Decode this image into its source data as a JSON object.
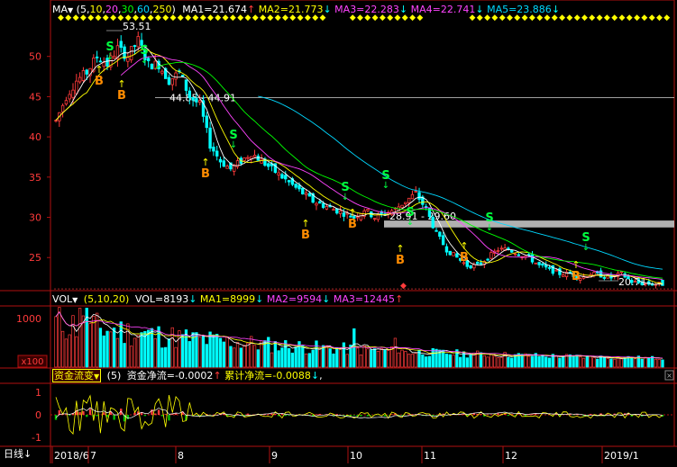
{
  "colors": {
    "bg": "#000000",
    "frame": "#b01010",
    "up": "#ff3b3b",
    "down": "#00ffff",
    "ma5": "#ffffff",
    "ma10": "#ffff00",
    "ma20": "#ff44ff",
    "ma30": "#00ff00",
    "ma60": "#00d8ff",
    "ma250": "#ffff00",
    "axis_text": "#ff3b3b",
    "grid": "#8b0000",
    "signal_b": "#ff8c00",
    "signal_s": "#00ff40",
    "ref": "#ffffff"
  },
  "main": {
    "indicator_label": "MA",
    "indicator_menu_icon": "triangle-down-icon",
    "params_open": "(",
    "params": [
      "5",
      "10",
      "20",
      "30",
      "60",
      "250"
    ],
    "params_close": ")",
    "ma1": "MA1=21.674",
    "ma2": "MA2=21.773",
    "ma3": "MA3=22.283",
    "ma4": "MA4=22.741",
    "ma5": "MA5=23.886",
    "y_ticks": [
      "50",
      "45",
      "40",
      "35",
      "30",
      "25"
    ],
    "annotations": {
      "high": "53.51",
      "low": "20.71",
      "band1": "44.85 - 44.91",
      "band2": "28.91 - 29.60"
    },
    "signal_buy": "B",
    "signal_sell": "S"
  },
  "volume": {
    "indicator_label": "VOL",
    "params": "(5,10,20)",
    "vol": "VOL=8193",
    "ma1": "MA1=8999",
    "ma2": "MA2=9594",
    "ma3": "MA3=12445",
    "y_tick": "1000",
    "unit": "x100"
  },
  "flow": {
    "indicator_label": "资金流变",
    "params": "(5)",
    "net": "资金净流=-0.0002",
    "cumulative": "累计净流=-0.0088",
    "trail": ",",
    "y_ticks": [
      "1",
      "0",
      "-1"
    ]
  },
  "bottom": {
    "period_label": "日线",
    "x_labels": [
      "2018/6",
      "7",
      "8",
      "9",
      "10",
      "11",
      "12",
      "2019/1"
    ]
  },
  "chart_data": [
    {
      "type": "candlestick",
      "title": "",
      "ylim": [
        21,
        55
      ],
      "y_ticks": [
        25,
        30,
        35,
        40,
        45,
        50
      ],
      "x_labels": [
        "2018/6",
        "7",
        "8",
        "9",
        "10",
        "11",
        "12",
        "2019/1"
      ],
      "close_path": [
        [
          0,
          42
        ],
        [
          3,
          45
        ],
        [
          6,
          47
        ],
        [
          9,
          48
        ],
        [
          12,
          50
        ],
        [
          15,
          49
        ],
        [
          18,
          51
        ],
        [
          21,
          50
        ],
        [
          24,
          52
        ],
        [
          27,
          49
        ],
        [
          30,
          49
        ],
        [
          33,
          47
        ],
        [
          36,
          48
        ],
        [
          39,
          45
        ],
        [
          42,
          44
        ],
        [
          45,
          39
        ],
        [
          48,
          37
        ],
        [
          51,
          36
        ],
        [
          54,
          37
        ],
        [
          57,
          38
        ],
        [
          60,
          37
        ],
        [
          63,
          36
        ],
        [
          66,
          35
        ],
        [
          69,
          34
        ],
        [
          72,
          33
        ],
        [
          75,
          32
        ],
        [
          78,
          31.5
        ],
        [
          81,
          31
        ],
        [
          84,
          30.5
        ],
        [
          87,
          30
        ],
        [
          90,
          31
        ],
        [
          93,
          30
        ],
        [
          96,
          30.5
        ],
        [
          99,
          31
        ],
        [
          102,
          32
        ],
        [
          105,
          33
        ],
        [
          108,
          31
        ],
        [
          111,
          28
        ],
        [
          114,
          26
        ],
        [
          117,
          25
        ],
        [
          120,
          24
        ],
        [
          123,
          24
        ],
        [
          126,
          25
        ],
        [
          129,
          26
        ],
        [
          132,
          26
        ],
        [
          135,
          25.5
        ],
        [
          138,
          25
        ],
        [
          141,
          24
        ],
        [
          144,
          23.5
        ],
        [
          147,
          23
        ],
        [
          150,
          23
        ],
        [
          153,
          22.5
        ],
        [
          156,
          23
        ],
        [
          159,
          22.8
        ],
        [
          162,
          22.5
        ],
        [
          165,
          23
        ],
        [
          168,
          22
        ],
        [
          171,
          21.8
        ],
        [
          174,
          21.7
        ],
        [
          177,
          21.7
        ]
      ],
      "buy_signals": 8,
      "sell_signals": 8,
      "high": 53.51,
      "low": 20.71,
      "ma_values": {
        "MA5": 21.674,
        "MA10": 21.773,
        "MA20": 22.283,
        "MA30": 22.741,
        "MA60": 23.886
      }
    },
    {
      "type": "bar",
      "title": "VOL",
      "ylim": [
        0,
        1400
      ],
      "values_note_ma": {
        "VOL": 8193,
        "MA1": 8999,
        "MA2": 9594,
        "MA3": 12445
      }
    },
    {
      "type": "bar",
      "title": "资金流变",
      "ylim": [
        -1.5,
        1.5
      ],
      "latest": {
        "net": -0.0002,
        "cumulative": -0.0088
      }
    }
  ]
}
